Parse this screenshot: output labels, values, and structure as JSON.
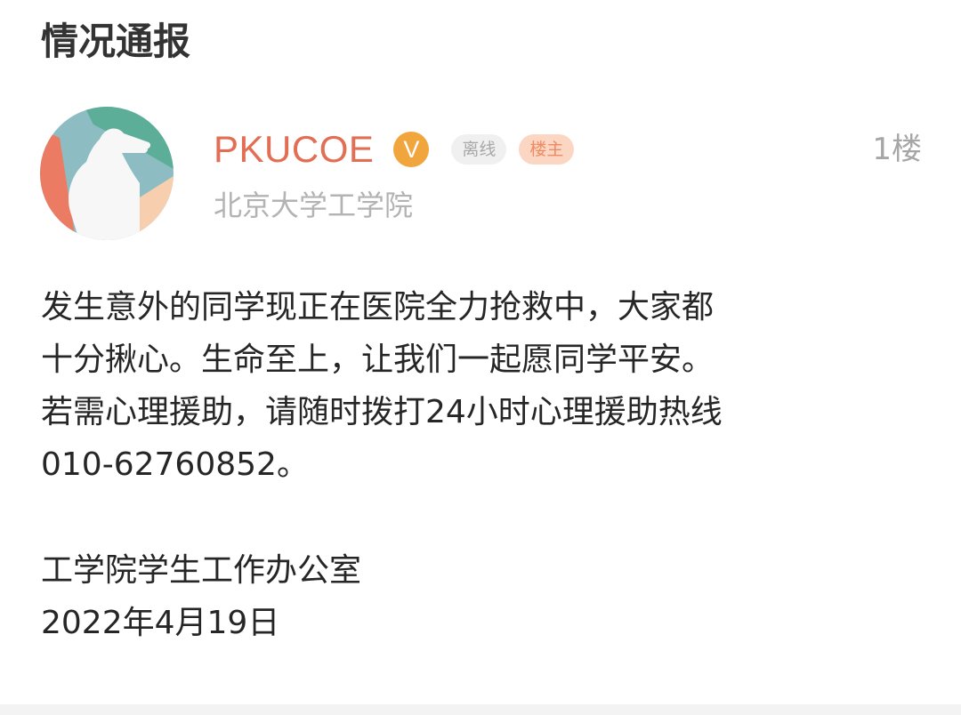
{
  "post": {
    "title": "情况通报"
  },
  "author": {
    "name": "PKUCOE",
    "verified_badge": "V",
    "status_tag": "离线",
    "owner_tag": "楼主",
    "subtitle": "北京大学工学院",
    "floor": "1楼",
    "avatar_icon": "saluting-person-avatar"
  },
  "body": {
    "lines": [
      "发生意外的同学现正在医院全力抢救中，大家都",
      "十分揪心。生命至上，让我们一起愿同学平安。",
      "若需心理援助，请随时拨打24小时心理援助热线",
      "010-62760852。"
    ],
    "signature": "工学院学生工作办公室",
    "date": "2022年4月19日"
  },
  "colors": {
    "author_name": "#e26e54",
    "verified_badge": "#f0a53d",
    "owner_tag_bg": "#fbd6c3",
    "owner_tag_text": "#ef8a63",
    "muted_text": "#b3b3b3",
    "avatar_teal": "#5cae98",
    "avatar_blue": "#8dbdc2",
    "avatar_red": "#ec7b63",
    "avatar_peach": "#f7cfae"
  }
}
